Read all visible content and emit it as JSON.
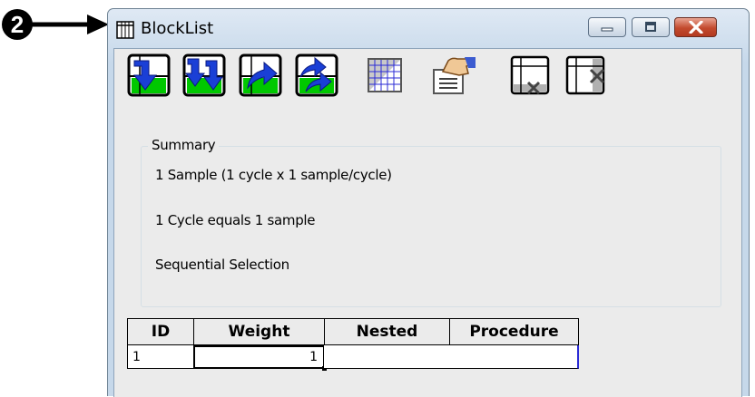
{
  "callout": {
    "number": "2"
  },
  "window": {
    "title": "BlockList",
    "icon": "grid-table-icon",
    "controls": [
      "minimize-icon",
      "maximize-icon",
      "close-icon"
    ]
  },
  "toolbar": {
    "buttons": [
      {
        "name": "move-down-icon"
      },
      {
        "name": "move-down-swap-icon"
      },
      {
        "name": "move-up-icon"
      },
      {
        "name": "move-up-swap-icon"
      },
      {
        "name": "grid-properties-icon"
      },
      {
        "name": "procedure-hand-icon"
      },
      {
        "name": "delete-row-icon"
      },
      {
        "name": "delete-column-icon"
      }
    ]
  },
  "summary": {
    "legend": "Summary",
    "lines": [
      "1 Sample (1 cycle x 1 sample/cycle)",
      "1 Cycle equals 1 sample",
      "Sequential Selection"
    ]
  },
  "grid": {
    "columns": [
      "ID",
      "Weight",
      "Nested",
      "Procedure"
    ],
    "rows": [
      {
        "id": "1",
        "weight": "1",
        "nested": "",
        "procedure": ""
      }
    ]
  }
}
